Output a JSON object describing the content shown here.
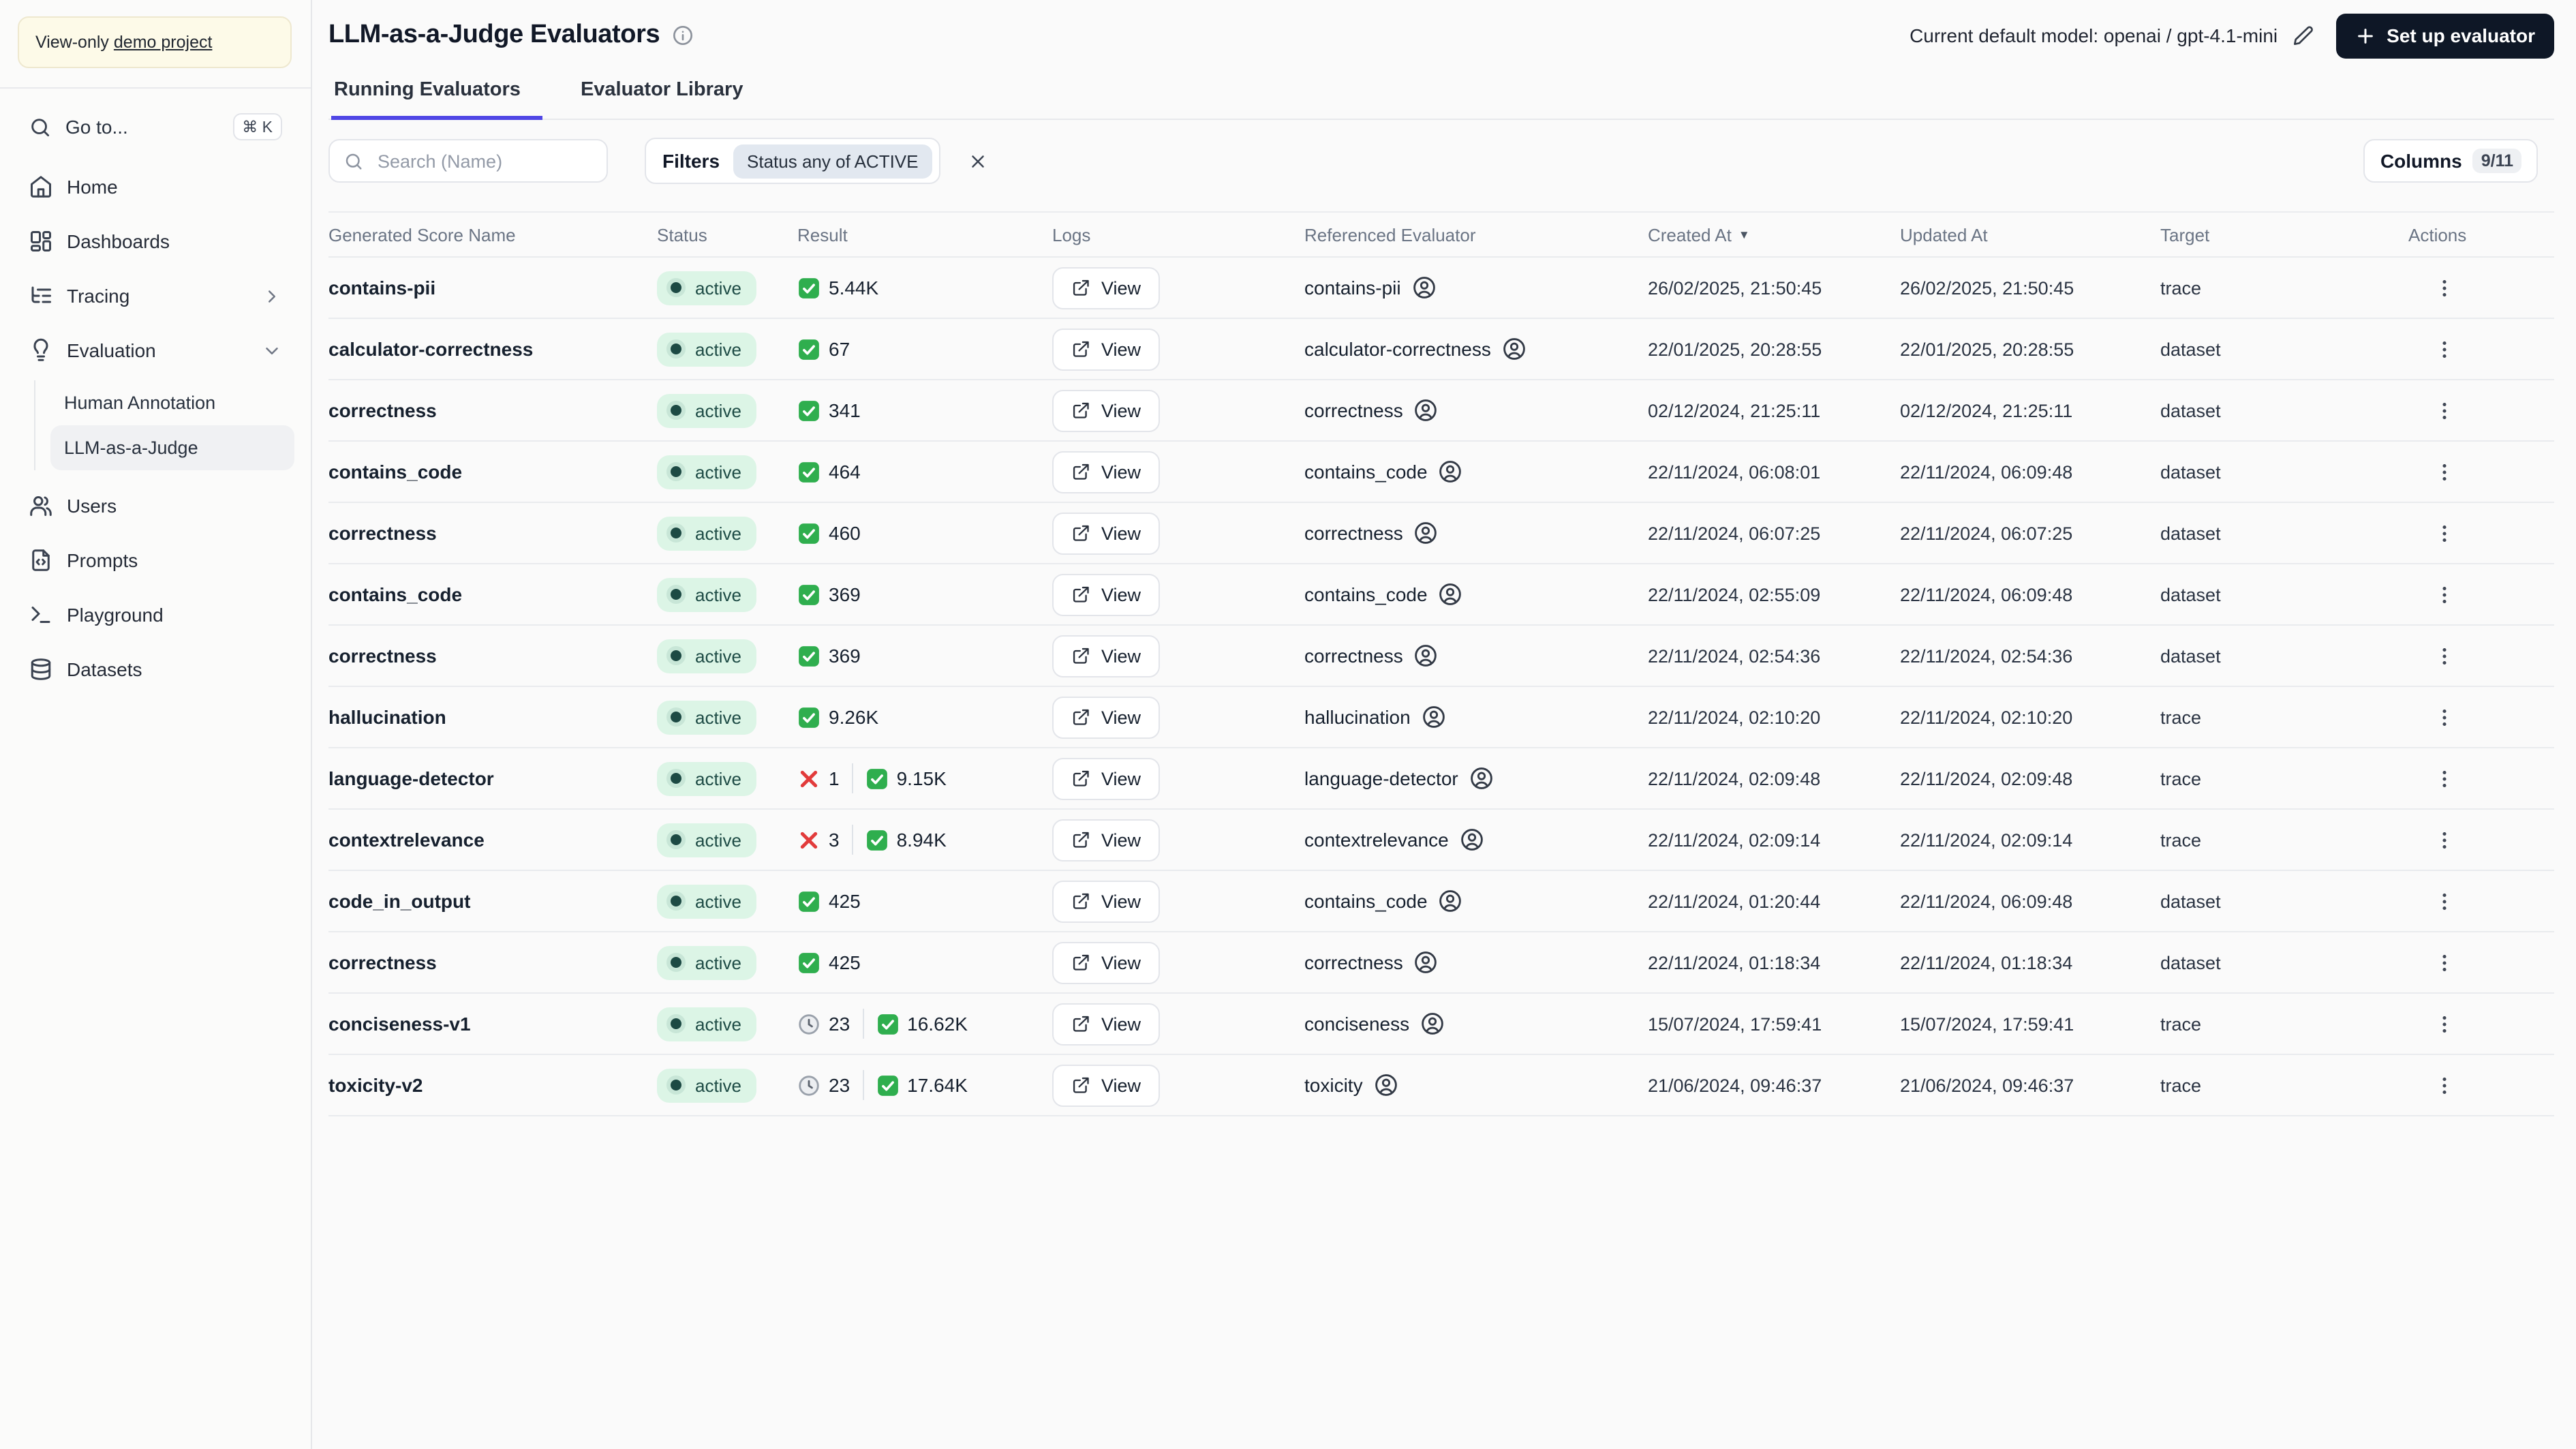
{
  "banner": {
    "prefix": "View-only",
    "link": "demo project"
  },
  "sidebar": {
    "goto": {
      "label": "Go to...",
      "shortcut": "⌘ K"
    },
    "items": [
      {
        "label": "Home",
        "icon": "home"
      },
      {
        "label": "Dashboards",
        "icon": "dashboards"
      },
      {
        "label": "Tracing",
        "icon": "tracing",
        "chevron": "right"
      },
      {
        "label": "Evaluation",
        "icon": "evaluation",
        "chevron": "down",
        "children": [
          {
            "label": "Human Annotation",
            "active": false
          },
          {
            "label": "LLM-as-a-Judge",
            "active": true
          }
        ]
      },
      {
        "label": "Users",
        "icon": "users"
      },
      {
        "label": "Prompts",
        "icon": "prompts"
      },
      {
        "label": "Playground",
        "icon": "playground"
      },
      {
        "label": "Datasets",
        "icon": "datasets"
      }
    ]
  },
  "header": {
    "title": "LLM-as-a-Judge Evaluators",
    "model_label": "Current default model: openai / gpt-4.1-mini",
    "setup_label": "Set up evaluator"
  },
  "tabs": [
    {
      "label": "Running Evaluators",
      "active": true
    },
    {
      "label": "Evaluator Library",
      "active": false
    }
  ],
  "toolbar": {
    "search_placeholder": "Search (Name)",
    "filters_label": "Filters",
    "filter_chip": "Status any of ACTIVE",
    "columns_label": "Columns",
    "columns_badge": "9/11"
  },
  "colors": {
    "accent_tab": "#4f46e5",
    "active_badge_bg": "#dcf5e6",
    "active_badge_text": "#1d4b45",
    "success_green": "#2fae4e",
    "error_red": "#e23b3b",
    "pending_gray": "#9aa1ab",
    "setup_button_bg": "#0e1726",
    "banner_bg": "#fdfae8"
  },
  "table": {
    "sort_desc_glyph": "▼",
    "logs_button": "View",
    "columns": [
      {
        "label": "Generated Score Name"
      },
      {
        "label": "Status"
      },
      {
        "label": "Result"
      },
      {
        "label": "Logs"
      },
      {
        "label": "Referenced Evaluator"
      },
      {
        "label": "Created At",
        "sort": "desc"
      },
      {
        "label": "Updated At"
      },
      {
        "label": "Target"
      },
      {
        "label": "Actions"
      }
    ],
    "rows": [
      {
        "name": "contains-pii",
        "status": "active",
        "result": [
          {
            "kind": "success",
            "value": "5.44K"
          }
        ],
        "referenced": "contains-pii",
        "created": "26/02/2025, 21:50:45",
        "updated": "26/02/2025, 21:50:45",
        "target": "trace"
      },
      {
        "name": "calculator-correctness",
        "status": "active",
        "result": [
          {
            "kind": "success",
            "value": "67"
          }
        ],
        "referenced": "calculator-correctness",
        "created": "22/01/2025, 20:28:55",
        "updated": "22/01/2025, 20:28:55",
        "target": "dataset"
      },
      {
        "name": "correctness",
        "status": "active",
        "result": [
          {
            "kind": "success",
            "value": "341"
          }
        ],
        "referenced": "correctness",
        "created": "02/12/2024, 21:25:11",
        "updated": "02/12/2024, 21:25:11",
        "target": "dataset"
      },
      {
        "name": "contains_code",
        "status": "active",
        "result": [
          {
            "kind": "success",
            "value": "464"
          }
        ],
        "referenced": "contains_code",
        "created": "22/11/2024, 06:08:01",
        "updated": "22/11/2024, 06:09:48",
        "target": "dataset"
      },
      {
        "name": "correctness",
        "status": "active",
        "result": [
          {
            "kind": "success",
            "value": "460"
          }
        ],
        "referenced": "correctness",
        "created": "22/11/2024, 06:07:25",
        "updated": "22/11/2024, 06:07:25",
        "target": "dataset"
      },
      {
        "name": "contains_code",
        "status": "active",
        "result": [
          {
            "kind": "success",
            "value": "369"
          }
        ],
        "referenced": "contains_code",
        "created": "22/11/2024, 02:55:09",
        "updated": "22/11/2024, 06:09:48",
        "target": "dataset"
      },
      {
        "name": "correctness",
        "status": "active",
        "result": [
          {
            "kind": "success",
            "value": "369"
          }
        ],
        "referenced": "correctness",
        "created": "22/11/2024, 02:54:36",
        "updated": "22/11/2024, 02:54:36",
        "target": "dataset"
      },
      {
        "name": "hallucination",
        "status": "active",
        "result": [
          {
            "kind": "success",
            "value": "9.26K"
          }
        ],
        "referenced": "hallucination",
        "created": "22/11/2024, 02:10:20",
        "updated": "22/11/2024, 02:10:20",
        "target": "trace"
      },
      {
        "name": "language-detector",
        "status": "active",
        "result": [
          {
            "kind": "error",
            "value": "1"
          },
          {
            "kind": "success",
            "value": "9.15K"
          }
        ],
        "referenced": "language-detector",
        "created": "22/11/2024, 02:09:48",
        "updated": "22/11/2024, 02:09:48",
        "target": "trace"
      },
      {
        "name": "contextrelevance",
        "status": "active",
        "result": [
          {
            "kind": "error",
            "value": "3"
          },
          {
            "kind": "success",
            "value": "8.94K"
          }
        ],
        "referenced": "contextrelevance",
        "created": "22/11/2024, 02:09:14",
        "updated": "22/11/2024, 02:09:14",
        "target": "trace"
      },
      {
        "name": "code_in_output",
        "status": "active",
        "result": [
          {
            "kind": "success",
            "value": "425"
          }
        ],
        "referenced": "contains_code",
        "created": "22/11/2024, 01:20:44",
        "updated": "22/11/2024, 06:09:48",
        "target": "dataset"
      },
      {
        "name": "correctness",
        "status": "active",
        "result": [
          {
            "kind": "success",
            "value": "425"
          }
        ],
        "referenced": "correctness",
        "created": "22/11/2024, 01:18:34",
        "updated": "22/11/2024, 01:18:34",
        "target": "dataset"
      },
      {
        "name": "conciseness-v1",
        "status": "active",
        "result": [
          {
            "kind": "pending",
            "value": "23"
          },
          {
            "kind": "success",
            "value": "16.62K"
          }
        ],
        "referenced": "conciseness",
        "created": "15/07/2024, 17:59:41",
        "updated": "15/07/2024, 17:59:41",
        "target": "trace"
      },
      {
        "name": "toxicity-v2",
        "status": "active",
        "result": [
          {
            "kind": "pending",
            "value": "23"
          },
          {
            "kind": "success",
            "value": "17.64K"
          }
        ],
        "referenced": "toxicity",
        "created": "21/06/2024, 09:46:37",
        "updated": "21/06/2024, 09:46:37",
        "target": "trace"
      }
    ]
  }
}
